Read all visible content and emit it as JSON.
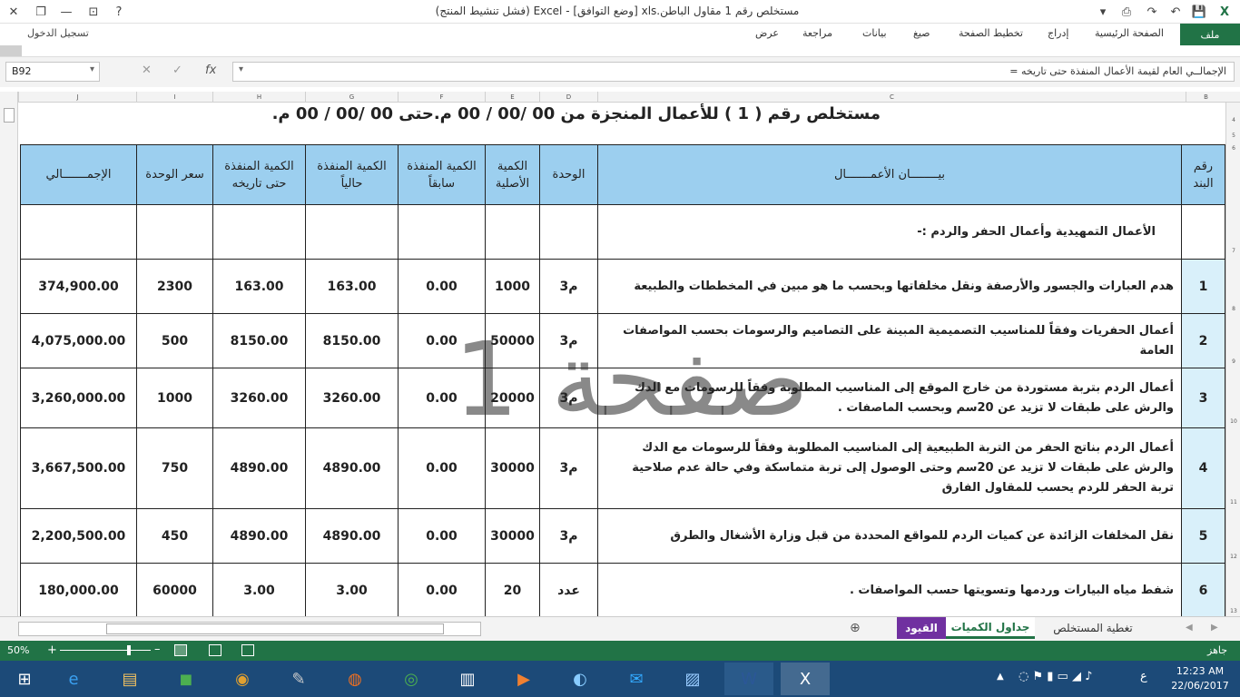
{
  "window": {
    "title": "مستخلص رقم 1 مقاول الباطن.xls  [وضع التوافق] - Excel (فشل تنشيط المنتج)"
  },
  "ribbon": {
    "tabs": [
      "ملف",
      "الصفحة الرئيسية",
      "إدراج",
      "تخطيط الصفحة",
      "صيغ",
      "بيانات",
      "مراجعة",
      "عرض"
    ],
    "signin": "تسجيل الدخول"
  },
  "formula_bar": {
    "name_box": "B92",
    "formula": "الإجمالــي العام لقيمة الأعمال المنفذة حتى تاريخه ="
  },
  "columns": [
    "B",
    "C",
    "D",
    "E",
    "F",
    "G",
    "H",
    "I",
    "J"
  ],
  "rows": [
    "4",
    "5",
    "6",
    "7",
    "8",
    "9",
    "10",
    "11",
    "12",
    "13"
  ],
  "sheet": {
    "heading": "مستخلص رقم ( 1 )    للأعمال المنجزة  من  00  /00  / 00 م.حتى  00  /00 / 00 م.",
    "headers": {
      "item_no": "رقم البند",
      "description": "بيــــــــان الأعمـــــــال",
      "unit": "الوحدة",
      "original_qty": "الكمية الأصلية",
      "prev_qty": "الكمية المنفذة سابقاً",
      "curr_qty": "الكمية المنفذة حالياً",
      "todate_qty": "الكمية المنفذة حتى تاريخه",
      "unit_price": "سعر الوحدة",
      "total": "الإجمـــــــالي"
    },
    "section_title": "الأعمال التمهيدية وأعمال الحفر والردم  :-",
    "rows": [
      {
        "no": "1",
        "desc": "هدم العبارات والجسور والأرصفة ونقل مخلفاتها وبحسب ما هو مبين في المخططات والطبيعة",
        "unit": "م3",
        "orig": "1000",
        "prev": "0.00",
        "curr": "163.00",
        "todate": "163.00",
        "price": "2300",
        "total": "374,900.00"
      },
      {
        "no": "2",
        "desc": "أعمال الحفريات وفقاً للمناسيب التصميمية المبينة على التصاميم والرسومات بحسب المواصفات العامة",
        "unit": "م3",
        "orig": "50000",
        "prev": "0.00",
        "curr": "8150.00",
        "todate": "8150.00",
        "price": "500",
        "total": "4,075,000.00"
      },
      {
        "no": "3",
        "desc": "أعمال الردم بتربة مستوردة من خارج الموقع إلى المناسيب المطلوبة وفقاً للرسومات مع الدك والرش على طبقات لا تزيد عن 20سم وبحسب الماصفات .",
        "unit": "م3",
        "orig": "20000",
        "prev": "0.00",
        "curr": "3260.00",
        "todate": "3260.00",
        "price": "1000",
        "total": "3,260,000.00"
      },
      {
        "no": "4",
        "desc": "أعمال الردم بناتج الحفر من التربة الطبيعية إلى المناسيب المطلوبة وفقاً للرسومات مع الدك والرش على طبقات لا تزيد عن 20سم  وحتى الوصول إلى تربة متماسكة وفي حالة عدم صلاحية تربة الحفر للردم يحسب للمقاول الفارق",
        "unit": "م3",
        "orig": "30000",
        "prev": "0.00",
        "curr": "4890.00",
        "todate": "4890.00",
        "price": "750",
        "total": "3,667,500.00"
      },
      {
        "no": "5",
        "desc": "نقل المخلفات الزائدة عن كميات الردم للمواقع المحددة من قبل وزارة الأشغال والطرق",
        "unit": "م3",
        "orig": "30000",
        "prev": "0.00",
        "curr": "4890.00",
        "todate": "4890.00",
        "price": "450",
        "total": "2,200,500.00"
      },
      {
        "no": "6",
        "desc": "شفط مياه البيارات وردمها وتسويتها حسب المواصفات .",
        "unit": "عدد",
        "orig": "20",
        "prev": "0.00",
        "curr": "3.00",
        "todate": "3.00",
        "price": "60000",
        "total": "180,000.00"
      }
    ],
    "watermark": "صفحة 1"
  },
  "sheet_tabs": [
    "تغطية المستخلص",
    "جداول الكميات",
    "القيود"
  ],
  "status": {
    "ready": "جاهز",
    "zoom": "50%"
  },
  "clock": {
    "time": "12:23 AM",
    "date": "22/06/2017",
    "lang": "ع"
  },
  "colors": {
    "excel_green": "#217346",
    "header_blue": "#9ccfef",
    "item_blue": "#d9f0fa",
    "tab_purple": "#7030a0"
  }
}
